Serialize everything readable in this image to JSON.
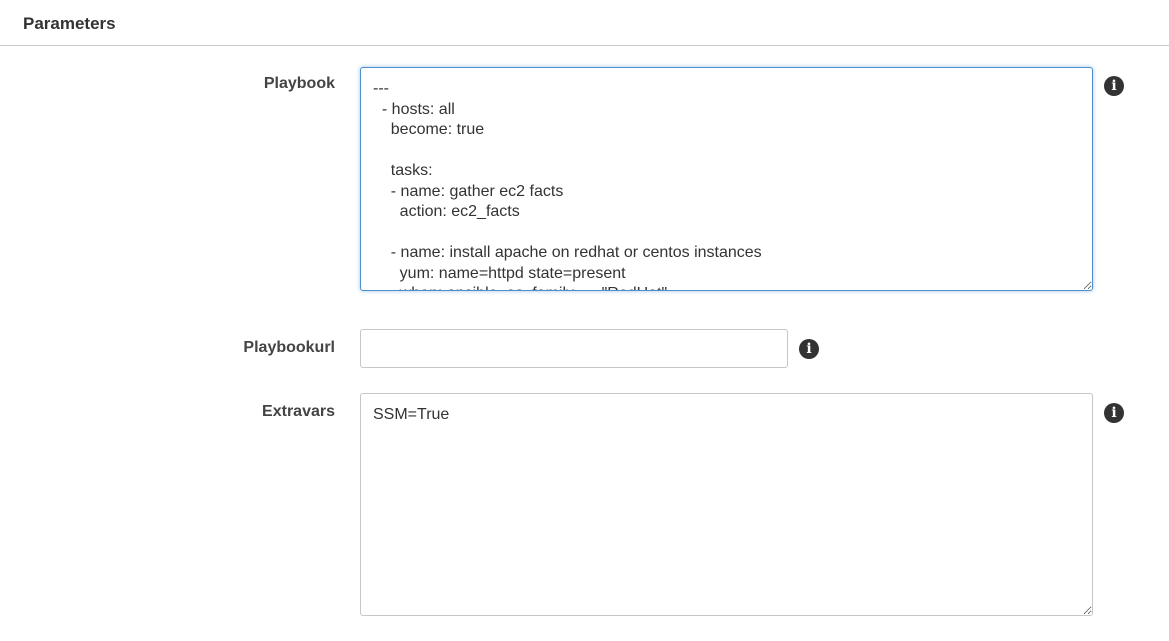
{
  "section": {
    "title": "Parameters"
  },
  "fields": {
    "playbook": {
      "label": "Playbook",
      "value": "---\n  - hosts: all\n    become: true\n\n    tasks:\n    - name: gather ec2 facts\n      action: ec2_facts\n\n    - name: install apache on redhat or centos instances\n      yum: name=httpd state=present\n      when: ansible_os_family == \"RedHat\""
    },
    "playbookurl": {
      "label": "Playbookurl",
      "value": ""
    },
    "extravars": {
      "label": "Extravars",
      "value": "SSM=True"
    }
  },
  "icons": {
    "info_glyph": "i"
  }
}
